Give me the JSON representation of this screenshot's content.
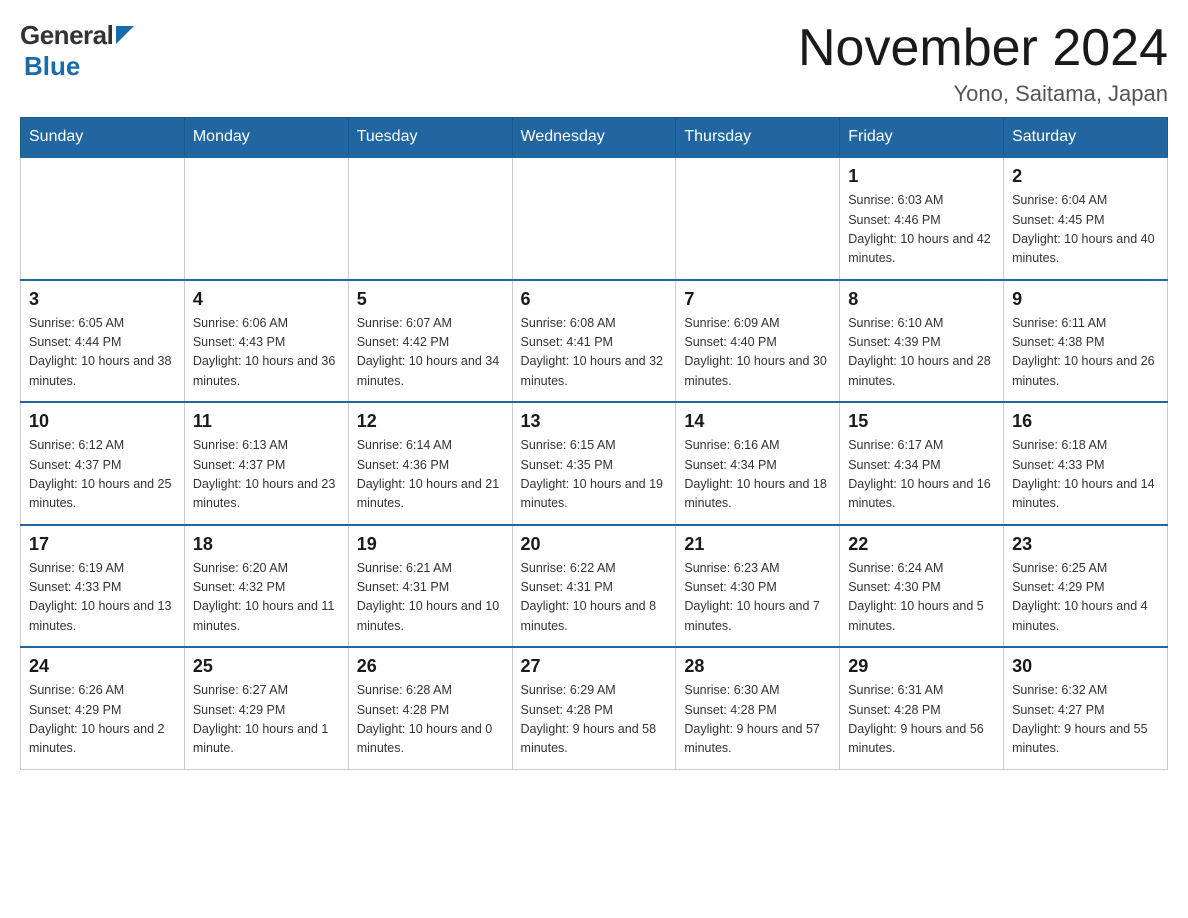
{
  "header": {
    "logo": {
      "general": "General",
      "blue": "Blue"
    },
    "month_title": "November 2024",
    "location": "Yono, Saitama, Japan"
  },
  "days_of_week": [
    "Sunday",
    "Monday",
    "Tuesday",
    "Wednesday",
    "Thursday",
    "Friday",
    "Saturday"
  ],
  "weeks": [
    [
      {
        "day": "",
        "info": ""
      },
      {
        "day": "",
        "info": ""
      },
      {
        "day": "",
        "info": ""
      },
      {
        "day": "",
        "info": ""
      },
      {
        "day": "",
        "info": ""
      },
      {
        "day": "1",
        "info": "Sunrise: 6:03 AM\nSunset: 4:46 PM\nDaylight: 10 hours and 42 minutes."
      },
      {
        "day": "2",
        "info": "Sunrise: 6:04 AM\nSunset: 4:45 PM\nDaylight: 10 hours and 40 minutes."
      }
    ],
    [
      {
        "day": "3",
        "info": "Sunrise: 6:05 AM\nSunset: 4:44 PM\nDaylight: 10 hours and 38 minutes."
      },
      {
        "day": "4",
        "info": "Sunrise: 6:06 AM\nSunset: 4:43 PM\nDaylight: 10 hours and 36 minutes."
      },
      {
        "day": "5",
        "info": "Sunrise: 6:07 AM\nSunset: 4:42 PM\nDaylight: 10 hours and 34 minutes."
      },
      {
        "day": "6",
        "info": "Sunrise: 6:08 AM\nSunset: 4:41 PM\nDaylight: 10 hours and 32 minutes."
      },
      {
        "day": "7",
        "info": "Sunrise: 6:09 AM\nSunset: 4:40 PM\nDaylight: 10 hours and 30 minutes."
      },
      {
        "day": "8",
        "info": "Sunrise: 6:10 AM\nSunset: 4:39 PM\nDaylight: 10 hours and 28 minutes."
      },
      {
        "day": "9",
        "info": "Sunrise: 6:11 AM\nSunset: 4:38 PM\nDaylight: 10 hours and 26 minutes."
      }
    ],
    [
      {
        "day": "10",
        "info": "Sunrise: 6:12 AM\nSunset: 4:37 PM\nDaylight: 10 hours and 25 minutes."
      },
      {
        "day": "11",
        "info": "Sunrise: 6:13 AM\nSunset: 4:37 PM\nDaylight: 10 hours and 23 minutes."
      },
      {
        "day": "12",
        "info": "Sunrise: 6:14 AM\nSunset: 4:36 PM\nDaylight: 10 hours and 21 minutes."
      },
      {
        "day": "13",
        "info": "Sunrise: 6:15 AM\nSunset: 4:35 PM\nDaylight: 10 hours and 19 minutes."
      },
      {
        "day": "14",
        "info": "Sunrise: 6:16 AM\nSunset: 4:34 PM\nDaylight: 10 hours and 18 minutes."
      },
      {
        "day": "15",
        "info": "Sunrise: 6:17 AM\nSunset: 4:34 PM\nDaylight: 10 hours and 16 minutes."
      },
      {
        "day": "16",
        "info": "Sunrise: 6:18 AM\nSunset: 4:33 PM\nDaylight: 10 hours and 14 minutes."
      }
    ],
    [
      {
        "day": "17",
        "info": "Sunrise: 6:19 AM\nSunset: 4:33 PM\nDaylight: 10 hours and 13 minutes."
      },
      {
        "day": "18",
        "info": "Sunrise: 6:20 AM\nSunset: 4:32 PM\nDaylight: 10 hours and 11 minutes."
      },
      {
        "day": "19",
        "info": "Sunrise: 6:21 AM\nSunset: 4:31 PM\nDaylight: 10 hours and 10 minutes."
      },
      {
        "day": "20",
        "info": "Sunrise: 6:22 AM\nSunset: 4:31 PM\nDaylight: 10 hours and 8 minutes."
      },
      {
        "day": "21",
        "info": "Sunrise: 6:23 AM\nSunset: 4:30 PM\nDaylight: 10 hours and 7 minutes."
      },
      {
        "day": "22",
        "info": "Sunrise: 6:24 AM\nSunset: 4:30 PM\nDaylight: 10 hours and 5 minutes."
      },
      {
        "day": "23",
        "info": "Sunrise: 6:25 AM\nSunset: 4:29 PM\nDaylight: 10 hours and 4 minutes."
      }
    ],
    [
      {
        "day": "24",
        "info": "Sunrise: 6:26 AM\nSunset: 4:29 PM\nDaylight: 10 hours and 2 minutes."
      },
      {
        "day": "25",
        "info": "Sunrise: 6:27 AM\nSunset: 4:29 PM\nDaylight: 10 hours and 1 minute."
      },
      {
        "day": "26",
        "info": "Sunrise: 6:28 AM\nSunset: 4:28 PM\nDaylight: 10 hours and 0 minutes."
      },
      {
        "day": "27",
        "info": "Sunrise: 6:29 AM\nSunset: 4:28 PM\nDaylight: 9 hours and 58 minutes."
      },
      {
        "day": "28",
        "info": "Sunrise: 6:30 AM\nSunset: 4:28 PM\nDaylight: 9 hours and 57 minutes."
      },
      {
        "day": "29",
        "info": "Sunrise: 6:31 AM\nSunset: 4:28 PM\nDaylight: 9 hours and 56 minutes."
      },
      {
        "day": "30",
        "info": "Sunrise: 6:32 AM\nSunset: 4:27 PM\nDaylight: 9 hours and 55 minutes."
      }
    ]
  ]
}
